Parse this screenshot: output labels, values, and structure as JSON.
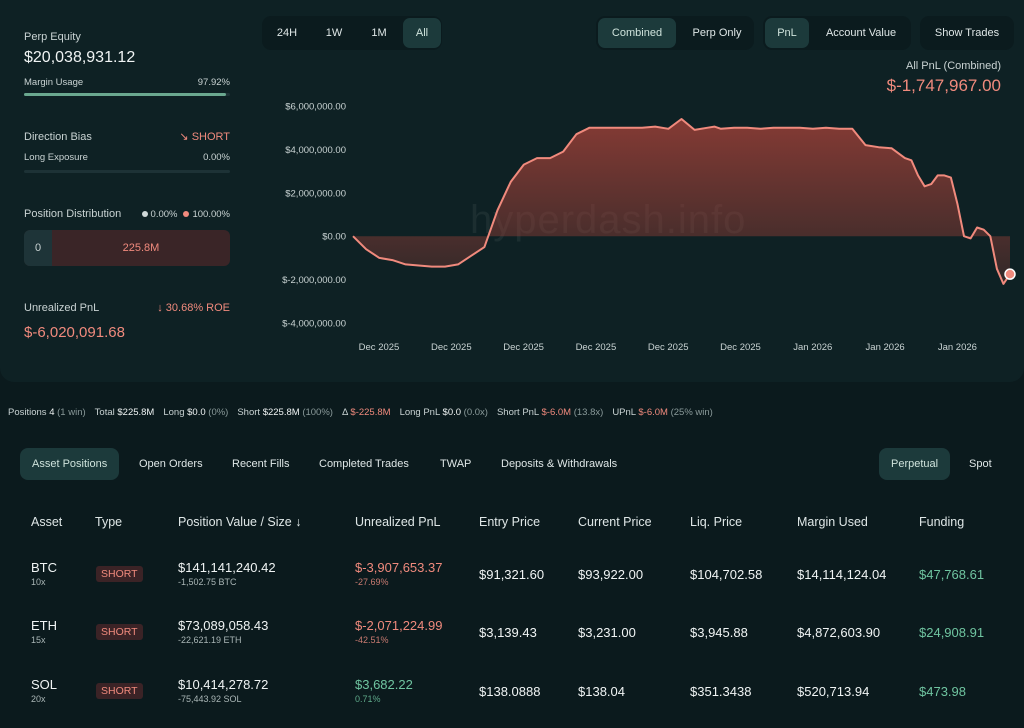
{
  "stats": {
    "perp_equity_label": "Perp Equity",
    "perp_equity_value": "$20,038,931.12",
    "margin_usage_label": "Margin Usage",
    "margin_usage_value": "97.92%",
    "margin_usage_fraction": 0.9792,
    "direction_bias_label": "Direction Bias",
    "direction_bias_value": "SHORT",
    "long_exposure_label": "Long Exposure",
    "long_exposure_value": "0.00%",
    "position_distribution_label": "Position Distribution",
    "dist_long_pct": "0.00%",
    "dist_short_pct": "100.00%",
    "dist_long_value": "0",
    "dist_short_value": "225.8M",
    "unrealized_pnl_label": "Unrealized PnL",
    "roe_value": "30.68% ROE",
    "unrealized_pnl_value": "$-6,020,091.68"
  },
  "controls": {
    "range": [
      "24H",
      "1W",
      "1M",
      "All"
    ],
    "active_range": "All",
    "mode": [
      "Combined",
      "Perp Only"
    ],
    "active_mode": "Combined",
    "metric": [
      "PnL",
      "Account Value"
    ],
    "active_metric": "PnL",
    "show_trades": "Show Trades"
  },
  "chart_header": {
    "label": "All PnL (Combined)",
    "value": "$-1,747,967.00"
  },
  "watermark": "hyperdash.info",
  "chart_data": {
    "type": "area",
    "ylim": [
      -4000000,
      6000000
    ],
    "y_ticks": [
      6000000,
      4000000,
      2000000,
      0,
      -2000000,
      -4000000
    ],
    "y_tick_labels": [
      "$6,000,000.00",
      "$4,000,000.00",
      "$2,000,000.00",
      "$0.00",
      "$-2,000,000.00",
      "$-4,000,000.00"
    ],
    "x_tick_labels": [
      "Dec 2025",
      "Dec 2025",
      "Dec 2025",
      "Dec 2025",
      "Dec 2025",
      "Dec 2025",
      "Jan 2026",
      "Jan 2026",
      "Jan 2026"
    ],
    "x": [
      0,
      2,
      4,
      6,
      8,
      10,
      12,
      14,
      16,
      18,
      20,
      22,
      24,
      26,
      28,
      30,
      32,
      34,
      36,
      38,
      40,
      42,
      44,
      46,
      48,
      50,
      52,
      54,
      55,
      56,
      58,
      60,
      62,
      64,
      66,
      68,
      70,
      72,
      74,
      76,
      78,
      80,
      82,
      84,
      85,
      86,
      87,
      88,
      89,
      90,
      91,
      92,
      93,
      94,
      95,
      96,
      97,
      98,
      99,
      100
    ],
    "values": [
      0,
      -600000,
      -1000000,
      -1100000,
      -1300000,
      -1350000,
      -1400000,
      -1400000,
      -1300000,
      -900000,
      -500000,
      1200000,
      2500000,
      3300000,
      3600000,
      3600000,
      3900000,
      4700000,
      5000000,
      5000000,
      5000000,
      5000000,
      5000000,
      5050000,
      4950000,
      5400000,
      4900000,
      5000000,
      5050000,
      4950000,
      5000000,
      5000000,
      4950000,
      5000000,
      5000000,
      5000000,
      4950000,
      5000000,
      4950000,
      4950000,
      4200000,
      4100000,
      4050000,
      3600000,
      3500000,
      2800000,
      2300000,
      2400000,
      2800000,
      2800000,
      2700000,
      1500000,
      0,
      -100000,
      400000,
      300000,
      0,
      -1500000,
      -2200000,
      -1750000
    ],
    "fill_color": "#9a3f37",
    "line_color": "#f08a7d"
  },
  "summary": {
    "positions_label": "Positions",
    "positions_count": "4",
    "positions_win": "(1 win)",
    "total_label": "Total",
    "total_value": "$225.8M",
    "long_label": "Long",
    "long_value": "$0.0",
    "long_pct": "(0%)",
    "short_label": "Short",
    "short_value": "$225.8M",
    "short_pct": "(100%)",
    "delta_label": "Δ",
    "delta_value": "$-225.8M",
    "long_pnl_label": "Long PnL",
    "long_pnl_value": "$0.0",
    "long_pnl_x": "(0.0x)",
    "short_pnl_label": "Short PnL",
    "short_pnl_value": "$-6.0M",
    "short_pnl_x": "(13.8x)",
    "upnl_label": "UPnL",
    "upnl_value": "$-6.0M",
    "upnl_win": "(25% win)"
  },
  "tabs": [
    "Asset Positions",
    "Open Orders",
    "Recent Fills",
    "Completed Trades",
    "TWAP",
    "Deposits & Withdrawals"
  ],
  "active_tab": "Asset Positions",
  "market_tabs": [
    "Perpetual",
    "Spot"
  ],
  "active_market_tab": "Perpetual",
  "table": {
    "headers": [
      "Asset",
      "Type",
      "Position Value / Size",
      "Unrealized PnL",
      "Entry Price",
      "Current Price",
      "Liq. Price",
      "Margin Used",
      "Funding"
    ],
    "sort_icon": "↓",
    "rows": [
      {
        "asset": "BTC",
        "leverage": "10x",
        "type": "SHORT",
        "value": "$141,141,240.42",
        "size": "-1,502.75 BTC",
        "upnl": "$-3,907,653.37",
        "upnl_pct": "-27.69%",
        "entry": "$91,321.60",
        "current": "$93,922.00",
        "liq": "$104,702.58",
        "margin": "$14,114,124.04",
        "funding": "$47,768.61"
      },
      {
        "asset": "ETH",
        "leverage": "15x",
        "type": "SHORT",
        "value": "$73,089,058.43",
        "size": "-22,621.19 ETH",
        "upnl": "$-2,071,224.99",
        "upnl_pct": "-42.51%",
        "entry": "$3,139.43",
        "current": "$3,231.00",
        "liq": "$3,945.88",
        "margin": "$4,872,603.90",
        "funding": "$24,908.91"
      },
      {
        "asset": "SOL",
        "leverage": "20x",
        "type": "SHORT",
        "value": "$10,414,278.72",
        "size": "-75,443.92 SOL",
        "upnl": "$3,682.22",
        "upnl_pct": "0.71%",
        "entry": "$138.0888",
        "current": "$138.04",
        "liq": "$351.3438",
        "margin": "$520,713.94",
        "funding": "$473.98"
      }
    ]
  }
}
